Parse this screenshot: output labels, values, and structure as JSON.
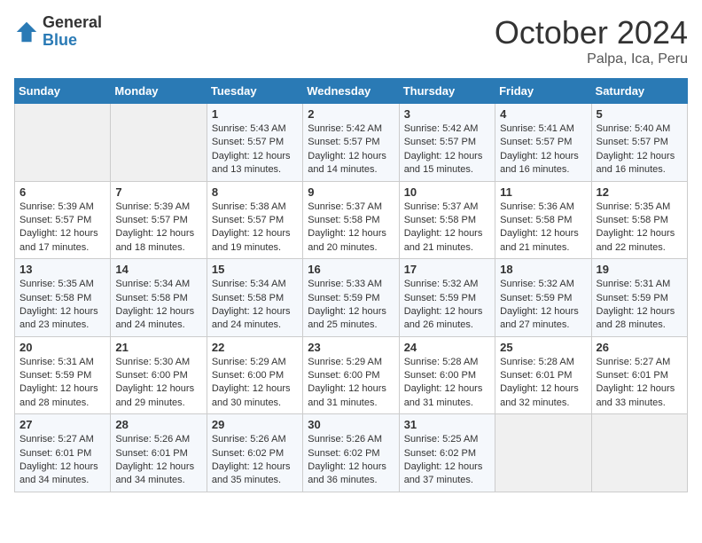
{
  "header": {
    "logo_general": "General",
    "logo_blue": "Blue",
    "month_title": "October 2024",
    "location": "Palpa, Ica, Peru"
  },
  "weekdays": [
    "Sunday",
    "Monday",
    "Tuesday",
    "Wednesday",
    "Thursday",
    "Friday",
    "Saturday"
  ],
  "weeks": [
    [
      {
        "day": "",
        "sunrise": "",
        "sunset": "",
        "daylight": ""
      },
      {
        "day": "",
        "sunrise": "",
        "sunset": "",
        "daylight": ""
      },
      {
        "day": "1",
        "sunrise": "Sunrise: 5:43 AM",
        "sunset": "Sunset: 5:57 PM",
        "daylight": "Daylight: 12 hours and 13 minutes."
      },
      {
        "day": "2",
        "sunrise": "Sunrise: 5:42 AM",
        "sunset": "Sunset: 5:57 PM",
        "daylight": "Daylight: 12 hours and 14 minutes."
      },
      {
        "day": "3",
        "sunrise": "Sunrise: 5:42 AM",
        "sunset": "Sunset: 5:57 PM",
        "daylight": "Daylight: 12 hours and 15 minutes."
      },
      {
        "day": "4",
        "sunrise": "Sunrise: 5:41 AM",
        "sunset": "Sunset: 5:57 PM",
        "daylight": "Daylight: 12 hours and 16 minutes."
      },
      {
        "day": "5",
        "sunrise": "Sunrise: 5:40 AM",
        "sunset": "Sunset: 5:57 PM",
        "daylight": "Daylight: 12 hours and 16 minutes."
      }
    ],
    [
      {
        "day": "6",
        "sunrise": "Sunrise: 5:39 AM",
        "sunset": "Sunset: 5:57 PM",
        "daylight": "Daylight: 12 hours and 17 minutes."
      },
      {
        "day": "7",
        "sunrise": "Sunrise: 5:39 AM",
        "sunset": "Sunset: 5:57 PM",
        "daylight": "Daylight: 12 hours and 18 minutes."
      },
      {
        "day": "8",
        "sunrise": "Sunrise: 5:38 AM",
        "sunset": "Sunset: 5:57 PM",
        "daylight": "Daylight: 12 hours and 19 minutes."
      },
      {
        "day": "9",
        "sunrise": "Sunrise: 5:37 AM",
        "sunset": "Sunset: 5:58 PM",
        "daylight": "Daylight: 12 hours and 20 minutes."
      },
      {
        "day": "10",
        "sunrise": "Sunrise: 5:37 AM",
        "sunset": "Sunset: 5:58 PM",
        "daylight": "Daylight: 12 hours and 21 minutes."
      },
      {
        "day": "11",
        "sunrise": "Sunrise: 5:36 AM",
        "sunset": "Sunset: 5:58 PM",
        "daylight": "Daylight: 12 hours and 21 minutes."
      },
      {
        "day": "12",
        "sunrise": "Sunrise: 5:35 AM",
        "sunset": "Sunset: 5:58 PM",
        "daylight": "Daylight: 12 hours and 22 minutes."
      }
    ],
    [
      {
        "day": "13",
        "sunrise": "Sunrise: 5:35 AM",
        "sunset": "Sunset: 5:58 PM",
        "daylight": "Daylight: 12 hours and 23 minutes."
      },
      {
        "day": "14",
        "sunrise": "Sunrise: 5:34 AM",
        "sunset": "Sunset: 5:58 PM",
        "daylight": "Daylight: 12 hours and 24 minutes."
      },
      {
        "day": "15",
        "sunrise": "Sunrise: 5:34 AM",
        "sunset": "Sunset: 5:58 PM",
        "daylight": "Daylight: 12 hours and 24 minutes."
      },
      {
        "day": "16",
        "sunrise": "Sunrise: 5:33 AM",
        "sunset": "Sunset: 5:59 PM",
        "daylight": "Daylight: 12 hours and 25 minutes."
      },
      {
        "day": "17",
        "sunrise": "Sunrise: 5:32 AM",
        "sunset": "Sunset: 5:59 PM",
        "daylight": "Daylight: 12 hours and 26 minutes."
      },
      {
        "day": "18",
        "sunrise": "Sunrise: 5:32 AM",
        "sunset": "Sunset: 5:59 PM",
        "daylight": "Daylight: 12 hours and 27 minutes."
      },
      {
        "day": "19",
        "sunrise": "Sunrise: 5:31 AM",
        "sunset": "Sunset: 5:59 PM",
        "daylight": "Daylight: 12 hours and 28 minutes."
      }
    ],
    [
      {
        "day": "20",
        "sunrise": "Sunrise: 5:31 AM",
        "sunset": "Sunset: 5:59 PM",
        "daylight": "Daylight: 12 hours and 28 minutes."
      },
      {
        "day": "21",
        "sunrise": "Sunrise: 5:30 AM",
        "sunset": "Sunset: 6:00 PM",
        "daylight": "Daylight: 12 hours and 29 minutes."
      },
      {
        "day": "22",
        "sunrise": "Sunrise: 5:29 AM",
        "sunset": "Sunset: 6:00 PM",
        "daylight": "Daylight: 12 hours and 30 minutes."
      },
      {
        "day": "23",
        "sunrise": "Sunrise: 5:29 AM",
        "sunset": "Sunset: 6:00 PM",
        "daylight": "Daylight: 12 hours and 31 minutes."
      },
      {
        "day": "24",
        "sunrise": "Sunrise: 5:28 AM",
        "sunset": "Sunset: 6:00 PM",
        "daylight": "Daylight: 12 hours and 31 minutes."
      },
      {
        "day": "25",
        "sunrise": "Sunrise: 5:28 AM",
        "sunset": "Sunset: 6:01 PM",
        "daylight": "Daylight: 12 hours and 32 minutes."
      },
      {
        "day": "26",
        "sunrise": "Sunrise: 5:27 AM",
        "sunset": "Sunset: 6:01 PM",
        "daylight": "Daylight: 12 hours and 33 minutes."
      }
    ],
    [
      {
        "day": "27",
        "sunrise": "Sunrise: 5:27 AM",
        "sunset": "Sunset: 6:01 PM",
        "daylight": "Daylight: 12 hours and 34 minutes."
      },
      {
        "day": "28",
        "sunrise": "Sunrise: 5:26 AM",
        "sunset": "Sunset: 6:01 PM",
        "daylight": "Daylight: 12 hours and 34 minutes."
      },
      {
        "day": "29",
        "sunrise": "Sunrise: 5:26 AM",
        "sunset": "Sunset: 6:02 PM",
        "daylight": "Daylight: 12 hours and 35 minutes."
      },
      {
        "day": "30",
        "sunrise": "Sunrise: 5:26 AM",
        "sunset": "Sunset: 6:02 PM",
        "daylight": "Daylight: 12 hours and 36 minutes."
      },
      {
        "day": "31",
        "sunrise": "Sunrise: 5:25 AM",
        "sunset": "Sunset: 6:02 PM",
        "daylight": "Daylight: 12 hours and 37 minutes."
      },
      {
        "day": "",
        "sunrise": "",
        "sunset": "",
        "daylight": ""
      },
      {
        "day": "",
        "sunrise": "",
        "sunset": "",
        "daylight": ""
      }
    ]
  ]
}
